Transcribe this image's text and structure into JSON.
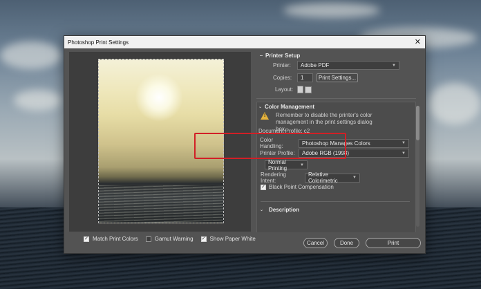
{
  "dialog": {
    "title": "Photoshop Print Settings"
  },
  "preview": {
    "checks": [
      {
        "label": "Match Print Colors",
        "checked": true
      },
      {
        "label": "Gamut Warning",
        "checked": false
      },
      {
        "label": "Show Paper White",
        "checked": true
      }
    ]
  },
  "printer_setup": {
    "title": "Printer Setup",
    "printer_label": "Printer:",
    "printer_value": "Adobe PDF",
    "copies_label": "Copies:",
    "copies_value": "1",
    "print_settings_label": "Print Settings...",
    "layout_label": "Layout:"
  },
  "color_management": {
    "title": "Color Management",
    "warning_text": "Remember to disable the printer's color management in the print settings dialog box.",
    "document_profile": "Document Profile: c2",
    "color_handling_label": "Color Handling:",
    "color_handling_value": "Photoshop Manages Colors",
    "printer_profile_label": "Printer Profile:",
    "printer_profile_value": "Adobe RGB (1998)",
    "normal_printing": "Normal Printing",
    "rendering_intent_label": "Rendering Intent:",
    "rendering_intent_value": "Relative Colorimetric",
    "bpc_label": "Black Point Compensation",
    "bpc_checked": true
  },
  "description": {
    "title": "Description"
  },
  "buttons": {
    "cancel": "Cancel",
    "done": "Done",
    "print": "Print"
  },
  "colors": {
    "highlight": "#d21f26",
    "dialog_bg": "#535353"
  }
}
